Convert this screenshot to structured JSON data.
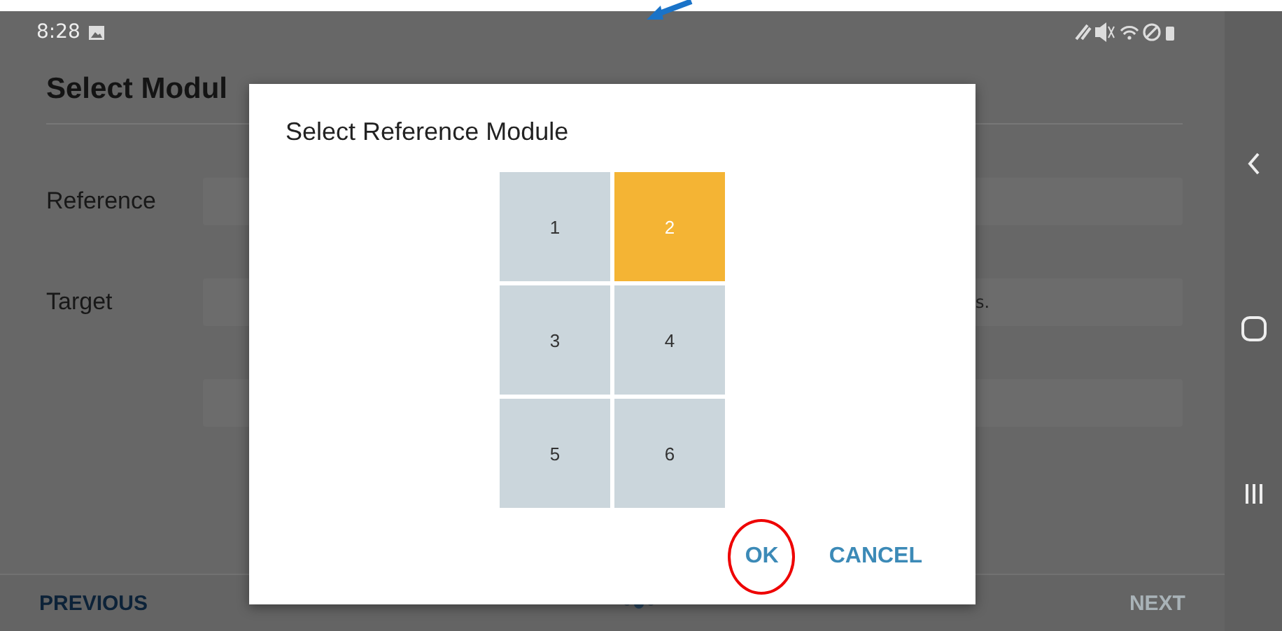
{
  "status_bar": {
    "time": "8:28"
  },
  "page": {
    "title": "Select Modul",
    "reference_label": "Reference",
    "target_label": "Target",
    "target_hint_fragment": "s."
  },
  "footer": {
    "previous": {
      "label": "PREVIOUS",
      "disabled": false
    },
    "next": {
      "label": "NEXT",
      "disabled": true
    },
    "dots": [
      {
        "selected": false
      },
      {
        "selected": true
      },
      {
        "selected": false
      }
    ]
  },
  "dialog": {
    "title": "Select Reference Module",
    "modules": [
      {
        "label": "1",
        "selected": false
      },
      {
        "label": "2",
        "selected": true
      },
      {
        "label": "3",
        "selected": false
      },
      {
        "label": "4",
        "selected": false
      },
      {
        "label": "5",
        "selected": false
      },
      {
        "label": "6",
        "selected": false
      }
    ],
    "buttons": [
      {
        "label": "OK",
        "circled": true
      },
      {
        "label": "CANCEL",
        "circled": false
      }
    ]
  }
}
